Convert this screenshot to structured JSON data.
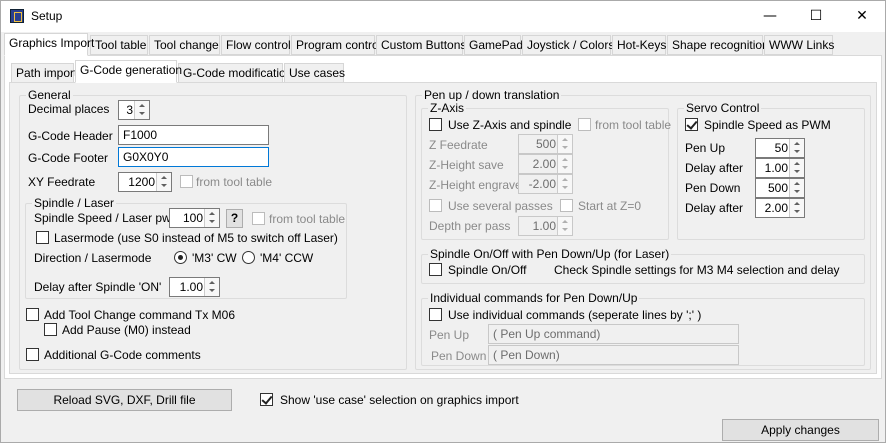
{
  "window": {
    "title": "Setup",
    "min_glyph": "—",
    "max_glyph": "☐",
    "close_glyph": "✕",
    "icon": "app-icon"
  },
  "main_tabs": [
    "Graphics Import",
    "Tool table",
    "Tool change",
    "Flow control",
    "Program control",
    "Custom Buttons",
    "GamePad",
    "Joystick / Colors",
    "Hot-Keys",
    "Shape recognition",
    "WWW Links"
  ],
  "sub_tabs": [
    "Path import",
    "G-Code generation",
    "G-Code modification",
    "Use cases"
  ],
  "general": {
    "legend": "General",
    "decimal_places_label": "Decimal places",
    "decimal_places": "3",
    "header_label": "G-Code Header",
    "header_value": "F1000",
    "footer_label": "G-Code Footer",
    "footer_value": "G0X0Y0",
    "xy_feedrate_label": "XY Feedrate",
    "xy_feedrate": "1200",
    "from_tool_table": "from tool table",
    "spindle": {
      "legend": "Spindle / Laser",
      "speed_label": "Spindle Speed / Laser pwr.",
      "speed": "100",
      "help": "?",
      "from_tool_table": "from tool table",
      "lasermode": "Lasermode (use S0 instead of M5 to switch off Laser)",
      "direction_label": "Direction / Lasermode",
      "cw": "'M3' CW",
      "ccw": "'M4' CCW",
      "delay_label": "Delay after Spindle 'ON'",
      "delay": "1.00"
    },
    "tool_change": "Add Tool Change command Tx M06",
    "pause": "Add Pause (M0) instead",
    "comments": "Additional G-Code comments"
  },
  "pen": {
    "legend": "Pen up / down translation",
    "zaxis": {
      "legend": "Z-Axis",
      "use": "Use Z-Axis and spindle",
      "from_tool_table": "from tool table",
      "feedrate_label": "Z Feedrate",
      "feedrate": "500",
      "save_label": "Z-Height save",
      "save": "2.00",
      "engrave_label": "Z-Height engrave",
      "engrave": "-2.00",
      "passes": "Use several passes",
      "start": "Start at Z=0",
      "depth_label": "Depth per pass",
      "depth": "1.00"
    },
    "servo": {
      "legend": "Servo Control",
      "pwm": "Spindle Speed as PWM",
      "up_label": "Pen Up",
      "up": "50",
      "delay1_label": "Delay after",
      "delay1": "1.00",
      "down_label": "Pen Down",
      "down": "500",
      "delay2_label": "Delay after",
      "delay2": "2.00"
    },
    "spindle_onoff": {
      "legend": "Spindle On/Off with Pen Down/Up (for Laser)",
      "check": "Spindle On/Off",
      "note": "Check Spindle settings for M3 M4 selection and delay"
    },
    "individual": {
      "legend": "Individual commands for Pen Down/Up",
      "check": "Use individual commands (seperate lines by ';' )",
      "up_label": "Pen Up",
      "up": "( Pen Up command)",
      "down_label": "Pen Down",
      "down": "( Pen Down)"
    }
  },
  "bottom": {
    "reload": "Reload SVG, DXF, Drill file",
    "show_use_case": "Show 'use case' selection on graphics import",
    "apply": "Apply changes"
  }
}
